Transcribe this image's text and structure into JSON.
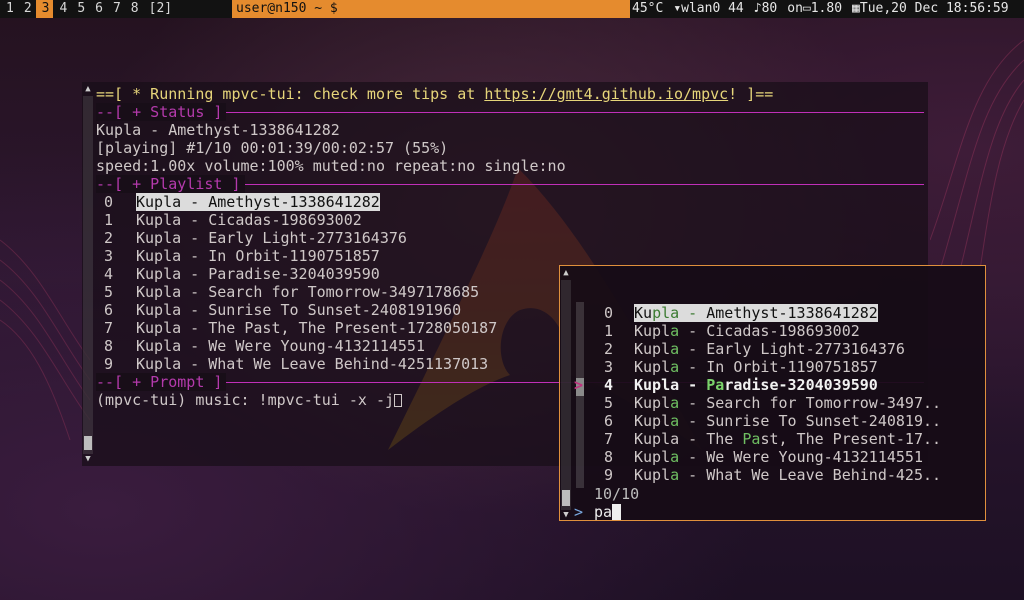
{
  "topbar": {
    "workspaces": [
      "1",
      "2",
      "3",
      "4",
      "5",
      "6",
      "7",
      "8",
      "[2]"
    ],
    "active_workspace": "3",
    "window_title": "user@n150 ~ $",
    "temperature": "45°C",
    "network": "wlan0 44",
    "volume": "80",
    "power": "on",
    "load": "1.80",
    "datetime": "Tue,20 Dec 18:56:59",
    "accent_color": "#e58b2e"
  },
  "terminal": {
    "banner_prefix": "==[ * Running mpvc-tui: check more tips at ",
    "banner_link": "https://gmt4.github.io/mpvc",
    "banner_suffix": "! ]==",
    "status_header": "--[ + Status ]",
    "now_playing": "Kupla - Amethyst-1338641282",
    "progress": "[playing] #1/10 00:01:39/00:02:57 (55%)",
    "flags": "speed:1.00x volume:100% muted:no repeat:no single:no",
    "playlist_header": "--[ + Playlist ]",
    "playlist": [
      {
        "num": "0",
        "title": "Kupla - Amethyst-1338641282"
      },
      {
        "num": "1",
        "title": "Kupla - Cicadas-198693002"
      },
      {
        "num": "2",
        "title": "Kupla - Early Light-2773164376"
      },
      {
        "num": "3",
        "title": "Kupla - In Orbit-1190751857"
      },
      {
        "num": "4",
        "title": "Kupla - Paradise-3204039590"
      },
      {
        "num": "5",
        "title": "Kupla - Search for Tomorrow-3497178685"
      },
      {
        "num": "6",
        "title": "Kupla - Sunrise To Sunset-2408191960"
      },
      {
        "num": "7",
        "title": "Kupla - The Past, The Present-1728050187"
      },
      {
        "num": "8",
        "title": "Kupla - We Were Young-4132114551"
      },
      {
        "num": "9",
        "title": "Kupla - What We Leave Behind-4251137013"
      }
    ],
    "prompt_header": "--[ + Prompt ]",
    "prompt_text": "(mpvc-tui) music: !mpvc-tui -x -j"
  },
  "fzf": {
    "rows": [
      {
        "num": "0",
        "a": "Ku",
        "b": "pla - ",
        "c": "A",
        "d": "methyst-1338641282",
        "selected": false
      },
      {
        "num": "1",
        "a": "Kupl",
        "b": "a",
        "c": " - Cicadas-198693002",
        "d": "",
        "selected": false
      },
      {
        "num": "2",
        "a": "Kupl",
        "b": "a",
        "c": " - Early Light-2773164376",
        "d": "",
        "selected": false
      },
      {
        "num": "3",
        "a": "Kupl",
        "b": "a",
        "c": " - In Orbit-1190751857",
        "d": "",
        "selected": false
      },
      {
        "num": "4",
        "a": "Kupla - ",
        "b": "Pa",
        "c": "radise-3204039590",
        "d": "",
        "selected": true
      },
      {
        "num": "5",
        "a": "Kupl",
        "b": "a",
        "c": " - Search for Tomorrow-3497..",
        "d": "",
        "selected": false
      },
      {
        "num": "6",
        "a": "Kupl",
        "b": "a",
        "c": " - Sunrise To Sunset-240819..",
        "d": "",
        "selected": false
      },
      {
        "num": "7",
        "a": "Kupla - The ",
        "b": "Pa",
        "c": "st, The Present-17..",
        "d": "",
        "selected": false
      },
      {
        "num": "8",
        "a": "Kupl",
        "b": "a",
        "c": " - We Were Young-4132114551",
        "d": "",
        "selected": false
      },
      {
        "num": "9",
        "a": "Kupl",
        "b": "a",
        "c": " - What We Leave Behind-425..",
        "d": "",
        "selected": false
      }
    ],
    "count": "10/10",
    "prompt_symbol": ">",
    "query": "pa",
    "pointer": ">"
  }
}
